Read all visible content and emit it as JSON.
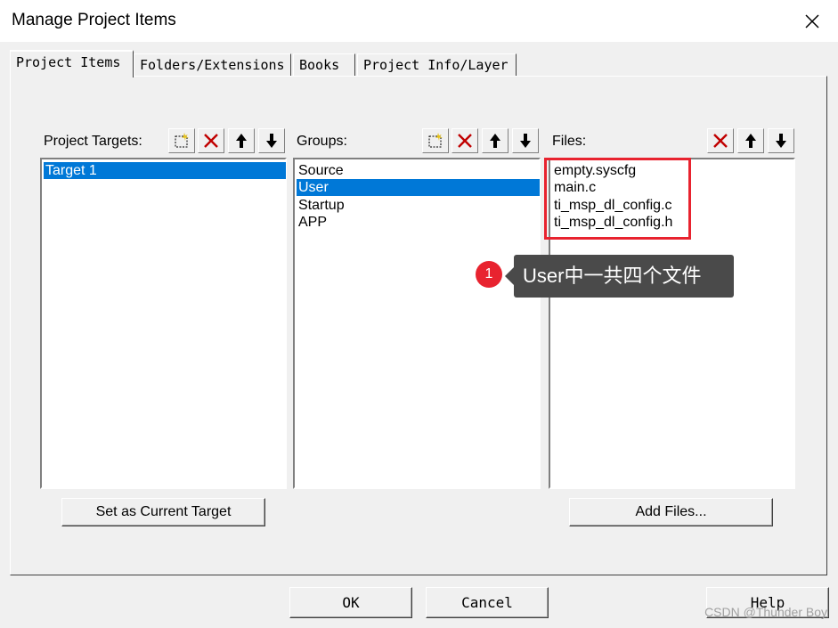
{
  "window": {
    "title": "Manage Project Items"
  },
  "tabs": [
    {
      "label": "Project Items"
    },
    {
      "label": "Folders/Extensions"
    },
    {
      "label": "Books"
    },
    {
      "label": "Project Info/Layer"
    }
  ],
  "targets": {
    "label": "Project Targets:",
    "items": [
      "Target 1"
    ],
    "selected": "Target 1"
  },
  "groups": {
    "label": "Groups:",
    "items": [
      "Source",
      "User",
      "Startup",
      "APP"
    ],
    "selected": "User"
  },
  "files": {
    "label": "Files:",
    "items": [
      "empty.syscfg",
      "main.c",
      "ti_msp_dl_config.c",
      "ti_msp_dl_config.h"
    ]
  },
  "buttons": {
    "set_current": "Set as Current Target",
    "add_files": "Add Files...",
    "ok": "OK",
    "cancel": "Cancel",
    "help": "Help"
  },
  "annotation": {
    "badge": "1",
    "text": "User中一共四个文件"
  },
  "watermark": "CSDN @Thunder Boy",
  "colors": {
    "selection": "#0078d7",
    "highlight": "#e8232f",
    "callout_bg": "#4a4a4a"
  }
}
